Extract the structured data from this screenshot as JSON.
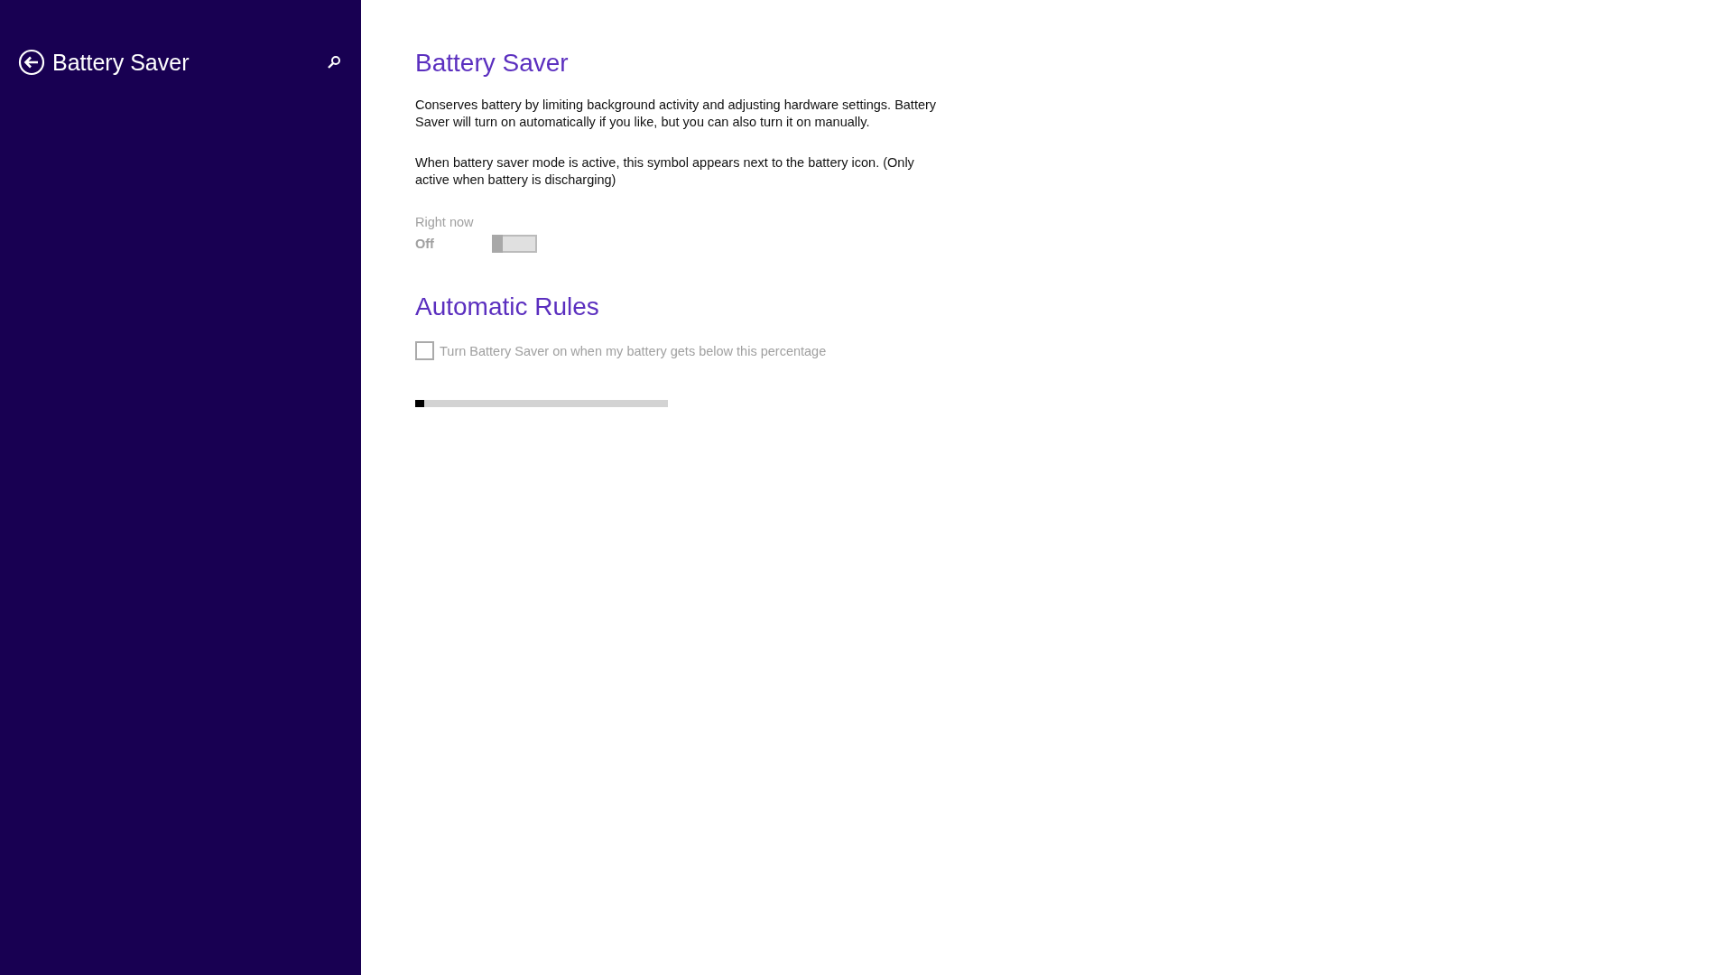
{
  "sidebar": {
    "title": "Battery Saver"
  },
  "page": {
    "title": "Battery Saver",
    "paragraphs": [
      "Conserves battery by limiting background activity and adjusting hardware settings. Battery Saver will turn on automatically if you like, but you can also turn it on manually.",
      "When battery saver mode is active, this symbol appears next to the battery icon. (Only active when battery is discharging)"
    ],
    "toggle": {
      "label": "Right now",
      "state_text": "Off",
      "on": false,
      "disabled": true
    },
    "rules_title": "Automatic Rules",
    "rule_checkbox": {
      "label": "Turn Battery Saver on when my battery gets below this percentage",
      "checked": false,
      "disabled": true
    },
    "slider": {
      "level": 0
    }
  }
}
